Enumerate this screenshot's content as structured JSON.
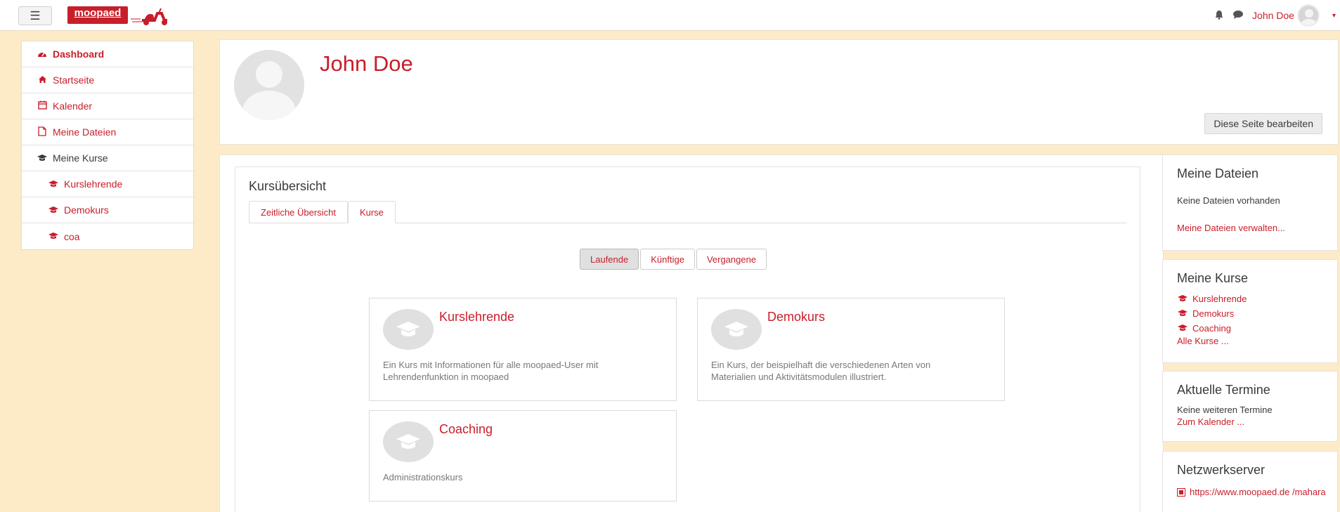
{
  "navbar": {
    "menu_icon": "☰",
    "logo_text": "moopaed",
    "bell_icon": "🔔",
    "chat_icon": "💬",
    "username": "John Doe",
    "caret": "▾"
  },
  "leftnav": {
    "items": [
      {
        "label": "Dashboard",
        "icon": "tachometer-icon",
        "glyph": "⏲"
      },
      {
        "label": "Startseite",
        "icon": "home-icon",
        "glyph": "⌂"
      },
      {
        "label": "Kalender",
        "icon": "calendar-icon",
        "glyph": "▦"
      },
      {
        "label": "Meine Dateien",
        "icon": "file-icon",
        "glyph": "▢"
      },
      {
        "label": "Meine Kurse",
        "icon": "graduation-cap-icon",
        "glyph": "🎓"
      },
      {
        "label": "Kurslehrende",
        "icon": "graduation-cap-icon",
        "glyph": "🎓"
      },
      {
        "label": "Demokurs",
        "icon": "graduation-cap-icon",
        "glyph": "🎓"
      },
      {
        "label": "coa",
        "icon": "graduation-cap-icon",
        "glyph": "🎓"
      }
    ]
  },
  "header": {
    "title": "John Doe",
    "edit_button": "Diese Seite bearbeiten"
  },
  "kursuebersicht": {
    "title": "Kursübersicht",
    "tabs": [
      {
        "label": "Zeitliche Übersicht"
      },
      {
        "label": "Kurse"
      }
    ],
    "filters": [
      {
        "label": "Laufende"
      },
      {
        "label": "Künftige"
      },
      {
        "label": "Vergangene"
      }
    ],
    "courses": [
      {
        "title": "Kurslehrende",
        "description": "Ein Kurs mit Informationen für alle moopaed-User mit Lehrendenfunktion in moopaed"
      },
      {
        "title": "Demokurs",
        "description": "Ein Kurs, der beispielhaft die verschiedenen Arten von Materialien und Aktivitätsmodulen illustriert."
      },
      {
        "title": "Coaching",
        "description": "Administrationskurs"
      }
    ]
  },
  "blocks": {
    "files": {
      "title": "Meine Dateien",
      "empty_text": "Keine Dateien vorhanden",
      "manage_link": "Meine Dateien verwalten..."
    },
    "courses": {
      "title": "Meine Kurse",
      "items": [
        {
          "label": "Kurslehrende"
        },
        {
          "label": "Demokurs"
        },
        {
          "label": "Coaching"
        }
      ],
      "all_link": "Alle Kurse ..."
    },
    "events": {
      "title": "Aktuelle Termine",
      "empty_text": "Keine weiteren Termine",
      "calendar_link": "Zum Kalender ..."
    },
    "network": {
      "title": "Netzwerkserver",
      "link": "https://www.moopaed.de /mahara"
    }
  },
  "colors": {
    "accent": "#c81e2a",
    "page_background": "#fdebc8"
  }
}
